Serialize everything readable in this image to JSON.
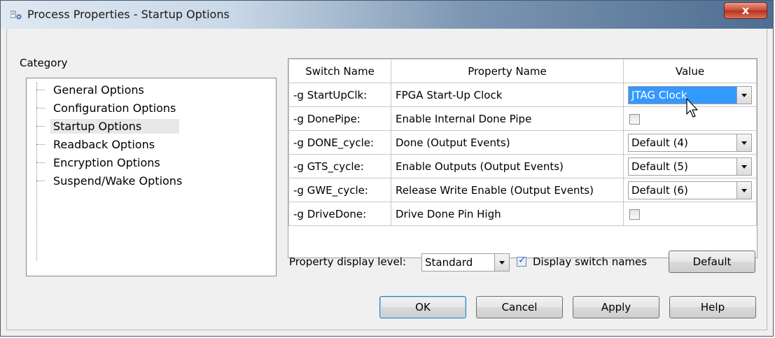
{
  "window": {
    "title": "Process Properties - Startup Options",
    "close_label": "x"
  },
  "category": {
    "label": "Category",
    "items": [
      {
        "label": "General Options"
      },
      {
        "label": "Configuration Options"
      },
      {
        "label": "Startup Options",
        "selected": true
      },
      {
        "label": "Readback Options"
      },
      {
        "label": "Encryption Options"
      },
      {
        "label": "Suspend/Wake Options"
      }
    ]
  },
  "table": {
    "headers": [
      "Switch Name",
      "Property Name",
      "Value"
    ],
    "rows": [
      {
        "switch": "-g StartUpClk:",
        "property": "FPGA Start-Up Clock",
        "value_type": "combo",
        "value": "JTAG Clock",
        "highlighted": true
      },
      {
        "switch": "-g DonePipe:",
        "property": "Enable Internal Done Pipe",
        "value_type": "checkbox",
        "checked": false
      },
      {
        "switch": "-g DONE_cycle:",
        "property": "Done (Output Events)",
        "value_type": "combo",
        "value": "Default (4)"
      },
      {
        "switch": "-g GTS_cycle:",
        "property": "Enable Outputs (Output Events)",
        "value_type": "combo",
        "value": "Default (5)"
      },
      {
        "switch": "-g GWE_cycle:",
        "property": "Release Write Enable (Output Events)",
        "value_type": "combo",
        "value": "Default (6)"
      },
      {
        "switch": "-g DriveDone:",
        "property": "Drive Done Pin High",
        "value_type": "checkbox",
        "checked": false
      }
    ]
  },
  "display": {
    "level_label": "Property display level:",
    "level_value": "Standard",
    "switch_names_label": "Display switch names",
    "switch_names_checked": true,
    "default_button": "Default"
  },
  "buttons": {
    "ok": "OK",
    "cancel": "Cancel",
    "apply": "Apply",
    "help": "Help"
  },
  "colors": {
    "selection": "#3399ff"
  }
}
